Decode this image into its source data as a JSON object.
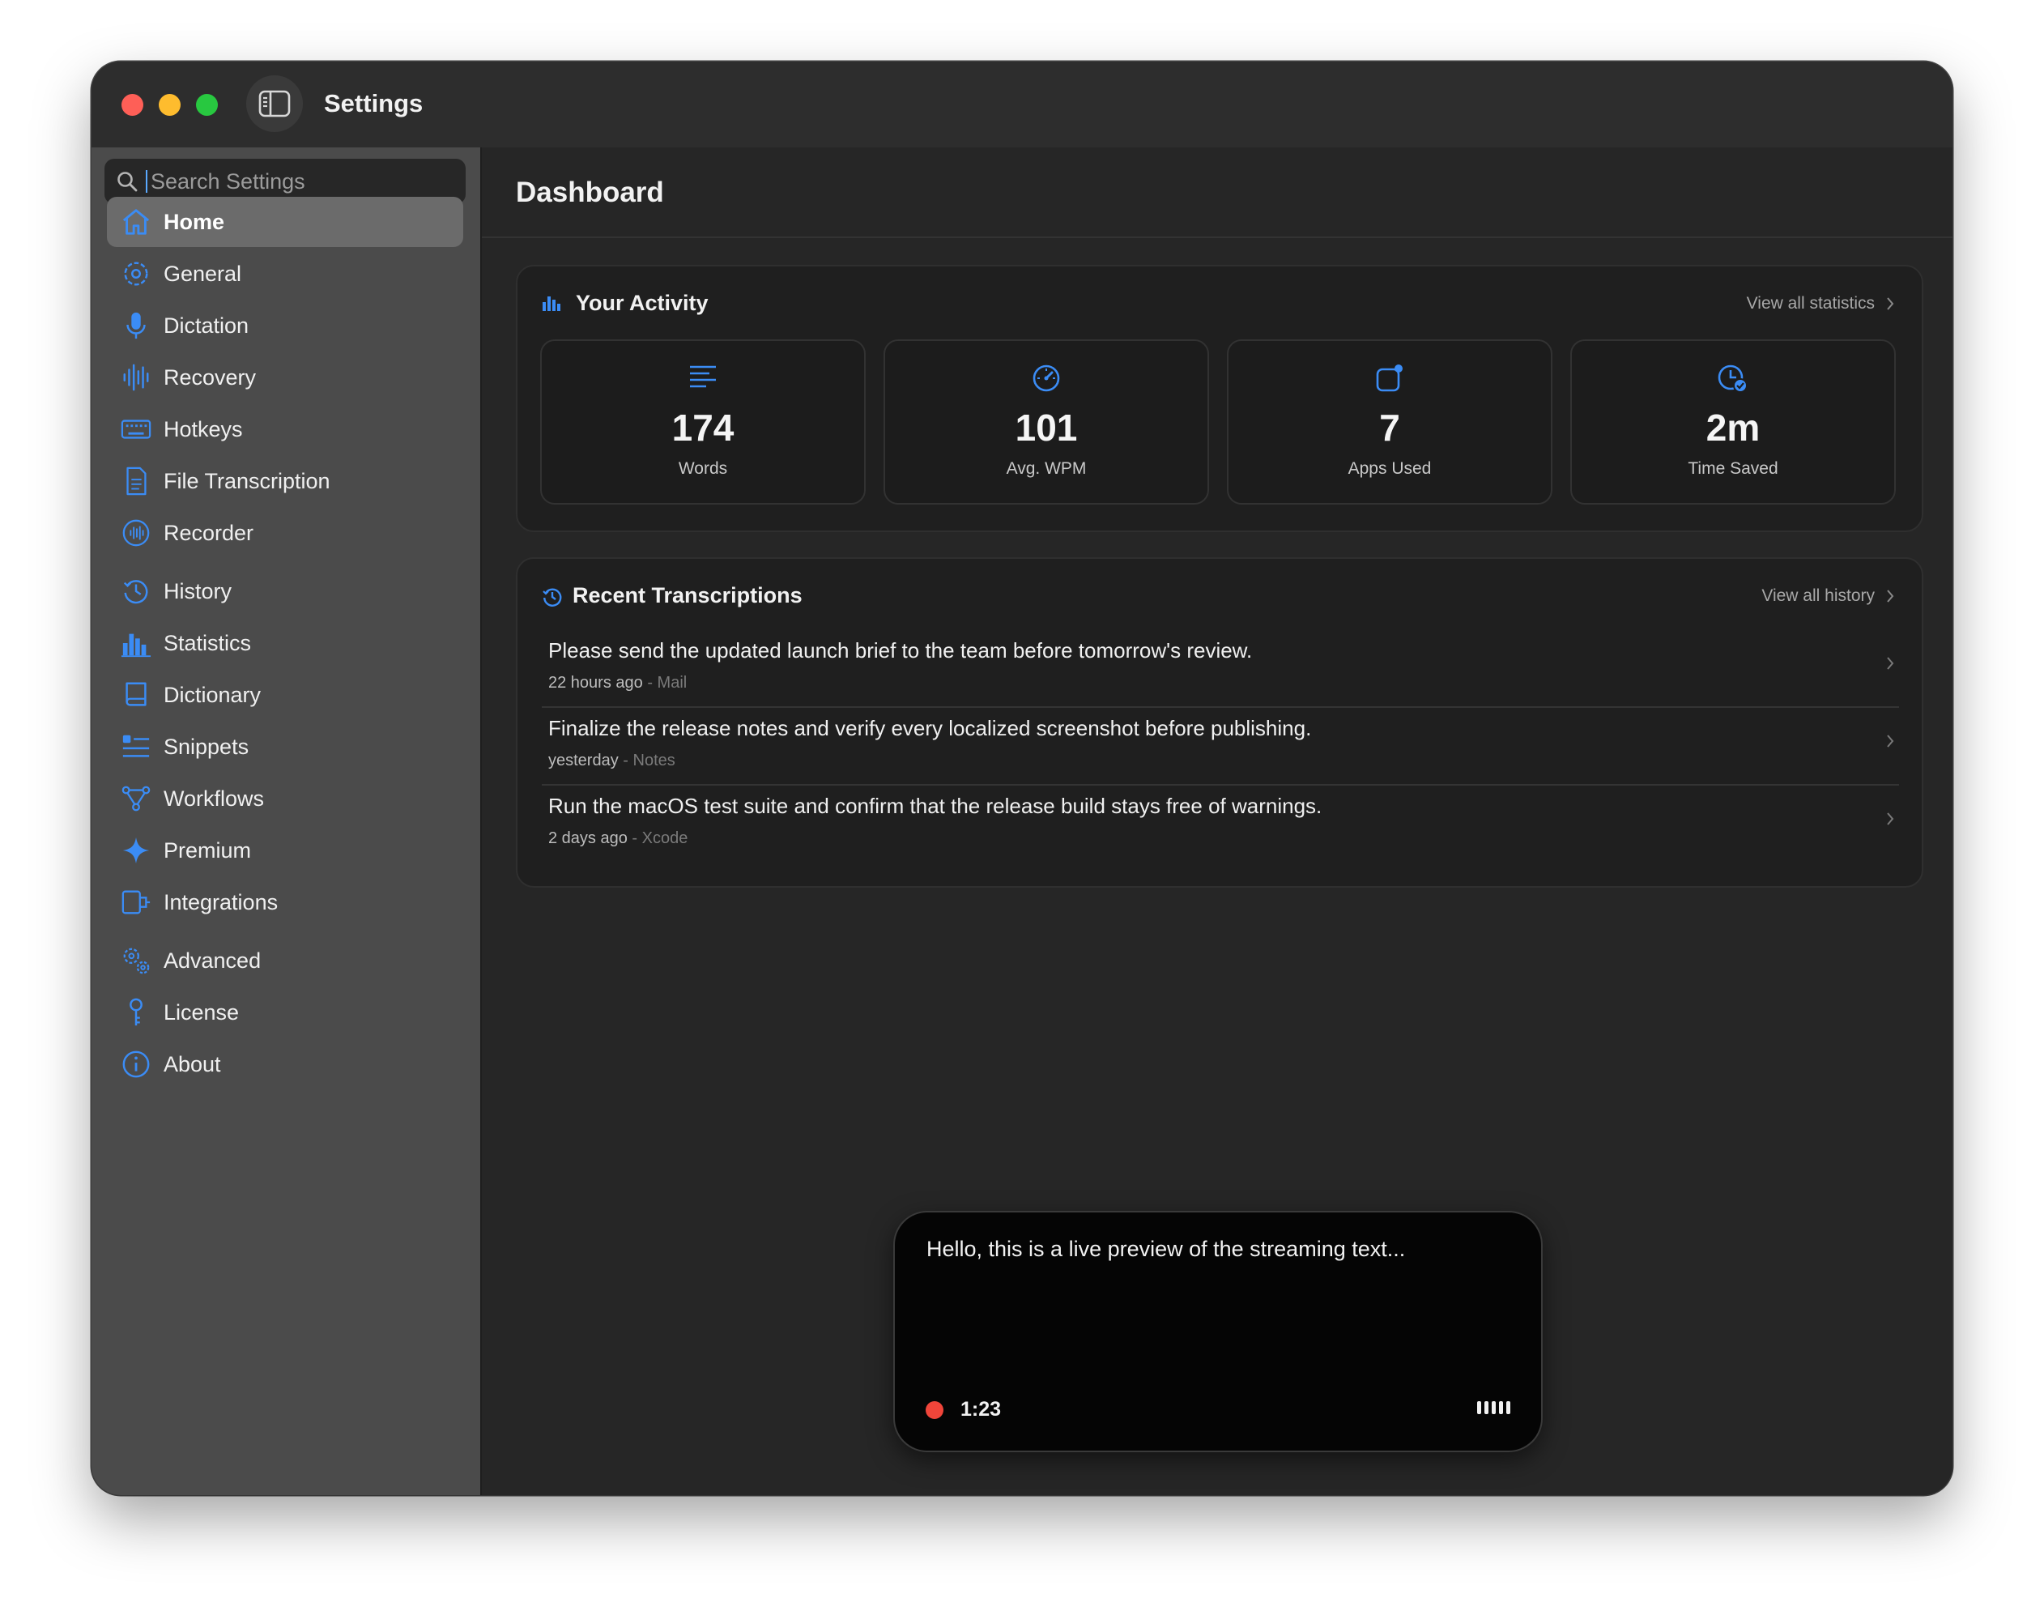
{
  "window": {
    "title": "Settings"
  },
  "search": {
    "placeholder": "Search Settings"
  },
  "sidebar": {
    "items": [
      {
        "label": "Home",
        "icon": "house-icon",
        "active": true
      },
      {
        "label": "General",
        "icon": "gear-icon"
      },
      {
        "label": "Dictation",
        "icon": "microphone-icon"
      },
      {
        "label": "Recovery",
        "icon": "waveform-icon"
      },
      {
        "label": "Hotkeys",
        "icon": "keyboard-icon"
      },
      {
        "label": "File Transcription",
        "icon": "document-icon"
      },
      {
        "label": "Recorder",
        "icon": "recorder-icon"
      },
      {
        "label": "History",
        "icon": "history-icon"
      },
      {
        "label": "Statistics",
        "icon": "bar-chart-icon"
      },
      {
        "label": "Dictionary",
        "icon": "book-icon"
      },
      {
        "label": "Snippets",
        "icon": "snippets-icon"
      },
      {
        "label": "Workflows",
        "icon": "workflow-icon"
      },
      {
        "label": "Premium",
        "icon": "sparkle-icon"
      },
      {
        "label": "Integrations",
        "icon": "integrations-icon"
      },
      {
        "label": "Advanced",
        "icon": "gears-icon"
      },
      {
        "label": "License",
        "icon": "key-icon"
      },
      {
        "label": "About",
        "icon": "info-icon"
      }
    ]
  },
  "main": {
    "title": "Dashboard",
    "activity": {
      "title": "Your Activity",
      "link": "View all statistics",
      "stats": [
        {
          "value": "174",
          "label": "Words",
          "icon": "text-lines-icon"
        },
        {
          "value": "101",
          "label": "Avg. WPM",
          "icon": "speedometer-icon"
        },
        {
          "value": "7",
          "label": "Apps Used",
          "icon": "app-badge-icon"
        },
        {
          "value": "2m",
          "label": "Time Saved",
          "icon": "clock-check-icon"
        }
      ]
    },
    "recent": {
      "title": "Recent Transcriptions",
      "link": "View all history",
      "items": [
        {
          "text": "Please send the updated launch brief to the team before tomorrow's review.",
          "time": "22 hours ago",
          "app": "- Mail"
        },
        {
          "text": "Finalize the release notes and verify every localized screenshot before publishing.",
          "time": "yesterday",
          "app": "- Notes"
        },
        {
          "text": "Run the macOS test suite and confirm that the release build stays free of warnings.",
          "time": "2 days ago",
          "app": "- Xcode"
        }
      ]
    }
  },
  "preview": {
    "text": "Hello, this is a live preview of the streaming text...",
    "time": "1:23"
  },
  "colors": {
    "accent": "#3b8cf5",
    "record": "#f0453a",
    "sidebar": "#4b4b4b",
    "background": "#262626"
  }
}
